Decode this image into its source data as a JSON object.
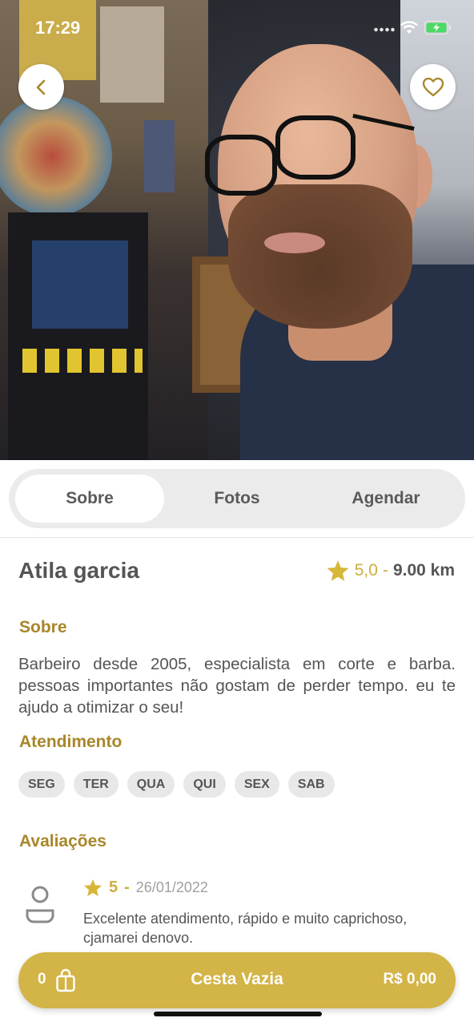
{
  "status_bar": {
    "time": "17:29"
  },
  "hero": {
    "photo_alt": "profile-photo"
  },
  "tabs": [
    {
      "label": "Sobre",
      "active": true
    },
    {
      "label": "Fotos",
      "active": false
    },
    {
      "label": "Agendar",
      "active": false
    }
  ],
  "profile": {
    "name": "Atila garcia",
    "rating": "5,0",
    "separator": "-",
    "distance": "9.00 km"
  },
  "sections": {
    "about_title": "Sobre",
    "about_text": "Barbeiro desde 2005, especialista em corte e barba. pessoas importantes não gostam de perder tempo. eu te ajudo a otimizar o seu!",
    "service_title": "Atendimento",
    "reviews_title": "Avaliações"
  },
  "days": [
    "SEG",
    "TER",
    "QUA",
    "QUI",
    "SEX",
    "SAB"
  ],
  "review": {
    "score": "5",
    "separator": "-",
    "date": "26/01/2022",
    "text": "Excelente atendimento, rápido e muito caprichoso, cjamarei denovo."
  },
  "cart": {
    "count": "0",
    "label": "Cesta Vazia",
    "total": "R$ 0,00"
  },
  "colors": {
    "accent": "#d3b446",
    "section_title": "#a8862a",
    "star": "#cdae3e"
  },
  "icons": [
    "back-chevron-icon",
    "heart-icon",
    "star-icon",
    "user-avatar-icon",
    "shopping-bag-icon",
    "wifi-icon",
    "battery-icon"
  ]
}
